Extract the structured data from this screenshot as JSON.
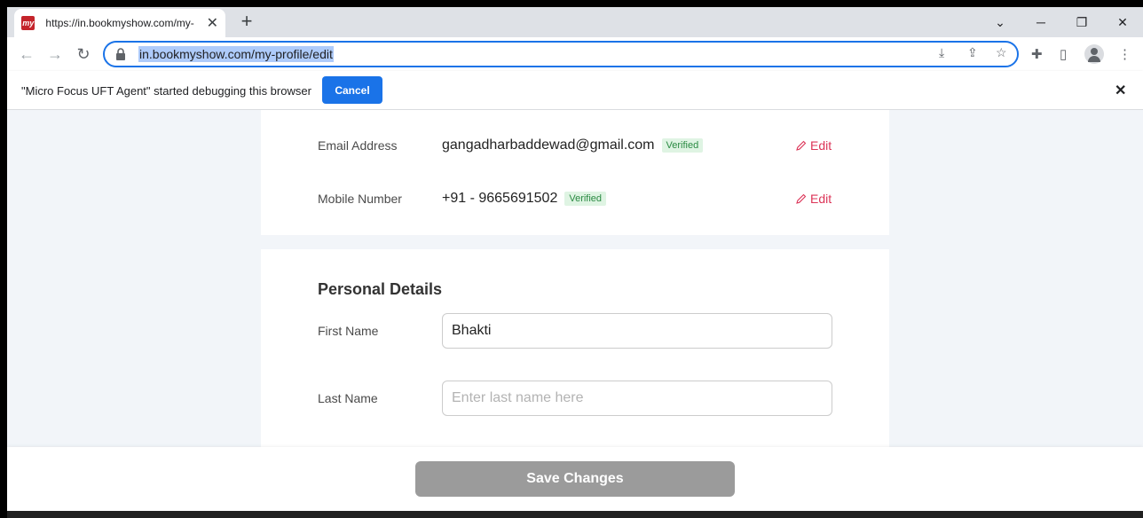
{
  "browser": {
    "tab_title": "https://in.bookmyshow.com/my-",
    "favicon_text": "my",
    "url": "in.bookmyshow.com/my-profile/edit"
  },
  "infobar": {
    "message": "\"Micro Focus UFT Agent\" started debugging this browser",
    "cancel_label": "Cancel"
  },
  "contact": {
    "email_label": "Email Address",
    "email_value": "gangadharbaddewad@gmail.com",
    "email_badge": "Verified",
    "mobile_label": "Mobile Number",
    "mobile_value": "+91 - 9665691502",
    "mobile_badge": "Verified",
    "edit_label": "Edit"
  },
  "personal": {
    "title": "Personal Details",
    "first_name_label": "First Name",
    "first_name_value": "Bhakti",
    "last_name_label": "Last Name",
    "last_name_placeholder": "Enter last name here"
  },
  "footer": {
    "save_label": "Save Changes"
  },
  "colors": {
    "accent": "#dc3558",
    "verified": "#2a8a42",
    "save_disabled": "#9b9b9b",
    "chrome_blue": "#1a73e8"
  }
}
